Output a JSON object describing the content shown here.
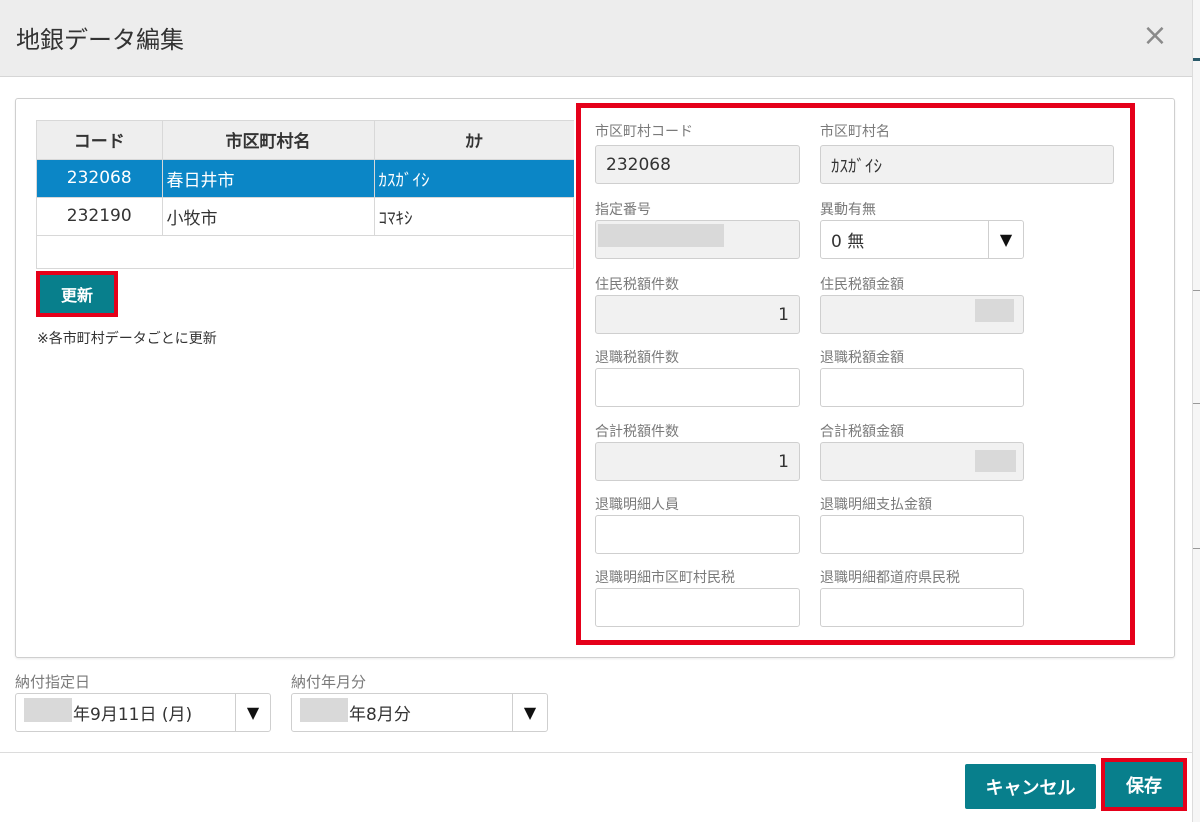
{
  "dialog": {
    "title": "地銀データ編集",
    "close_glyph": "×"
  },
  "table": {
    "headers": [
      "コード",
      "市区町村名",
      "ｶﾅ"
    ],
    "rows": [
      {
        "code": "232068",
        "name": "春日井市",
        "kana": "ｶｽｶﾞｲｼ",
        "selected": true
      },
      {
        "code": "232190",
        "name": "小牧市",
        "kana": "ｺﾏｷｼ",
        "selected": false
      }
    ]
  },
  "update_button": {
    "label": "更新"
  },
  "note": "※各市町村データごとに更新",
  "form": {
    "muni_code": {
      "label": "市区町村コード",
      "value": "232068"
    },
    "muni_name": {
      "label": "市区町村名",
      "value": "ｶｽｶﾞｲｼ"
    },
    "designation_no": {
      "label": "指定番号",
      "value": ""
    },
    "change_flag": {
      "label": "異動有無",
      "value": "0 無"
    },
    "resident_count": {
      "label": "住民税額件数",
      "value": "1"
    },
    "resident_amount": {
      "label": "住民税額金額",
      "value": ""
    },
    "retire_count": {
      "label": "退職税額件数",
      "value": ""
    },
    "retire_amount": {
      "label": "退職税額金額",
      "value": ""
    },
    "total_count": {
      "label": "合計税額件数",
      "value": "1"
    },
    "total_amount": {
      "label": "合計税額金額",
      "value": ""
    },
    "retire_detail_people": {
      "label": "退職明細人員",
      "value": ""
    },
    "retire_detail_paid": {
      "label": "退職明細支払金額",
      "value": ""
    },
    "retire_detail_muni_tax": {
      "label": "退職明細市区町村民税",
      "value": ""
    },
    "retire_detail_pref_tax": {
      "label": "退職明細都道府県民税",
      "value": ""
    }
  },
  "payment_date": {
    "label": "納付指定日",
    "value": "年9月11日 (月)"
  },
  "payment_period": {
    "label": "納付年月分",
    "value": "年8月分"
  },
  "arrow_glyph": "▼",
  "footer": {
    "cancel_label": "キャンセル",
    "save_label": "保存"
  },
  "colors": {
    "accent": "#087f8c",
    "selected_row": "#0b86c6",
    "highlight": "#e5001a",
    "header_bg": "#ededed"
  }
}
